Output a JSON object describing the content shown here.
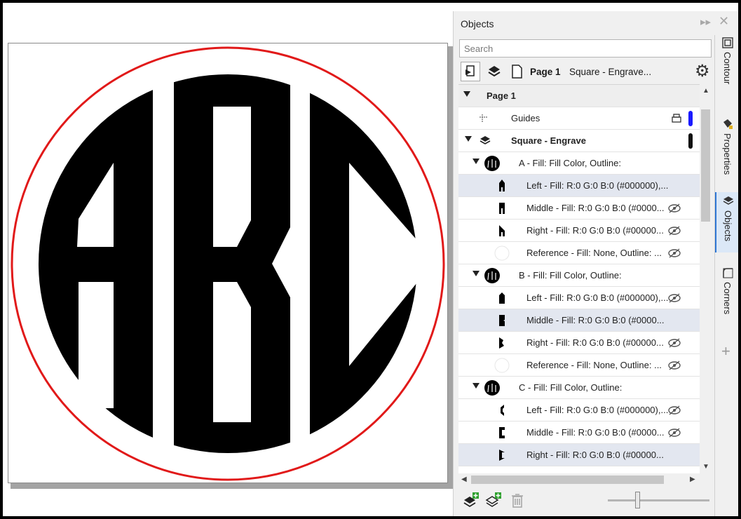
{
  "canvas": {
    "monogram_letters": [
      "A",
      "B",
      "C"
    ],
    "colors": {
      "fill": "#000000",
      "outline": "#e11919",
      "page": "#ffffff"
    }
  },
  "panel": {
    "title": "Objects",
    "search_placeholder": "Search",
    "toolbar": {
      "page_label": "Page 1",
      "layer_label": "Square - Engrave..."
    },
    "tree": {
      "page": "Page 1",
      "guides": "Guides",
      "layer": "Square - Engrave",
      "groups": [
        {
          "label": "A - Fill: Fill Color, Outline:",
          "children": [
            "Left - Fill: R:0 G:0 B:0 (#000000),...",
            "Middle - Fill: R:0 G:0 B:0 (#0000...",
            "Right - Fill: R:0 G:0 B:0 (#00000...",
            "Reference - Fill: None, Outline: ..."
          ]
        },
        {
          "label": "B - Fill: Fill Color, Outline:",
          "children": [
            "Left - Fill: R:0 G:0 B:0 (#000000),...",
            "Middle - Fill: R:0 G:0 B:0 (#0000...",
            "Right - Fill: R:0 G:0 B:0 (#00000...",
            "Reference - Fill: None, Outline: ..."
          ]
        },
        {
          "label": "C - Fill: Fill Color, Outline:",
          "children": [
            "Left - Fill: R:0 G:0 B:0 (#000000),...",
            "Middle - Fill: R:0 G:0 B:0 (#0000...",
            "Right - Fill: R:0 G:0 B:0 (#00000..."
          ]
        }
      ]
    }
  },
  "side_tabs": [
    "Contour",
    "Properties",
    "Objects",
    "Corners"
  ],
  "icons": [
    "collapse-panel-icon",
    "close-icon",
    "gear-icon",
    "eye-hidden-icon",
    "new-layer-icon",
    "new-master-layer-icon",
    "trash-icon",
    "plus-icon"
  ],
  "accent": "#2f77d4",
  "selection_color": "#e3e7f0"
}
